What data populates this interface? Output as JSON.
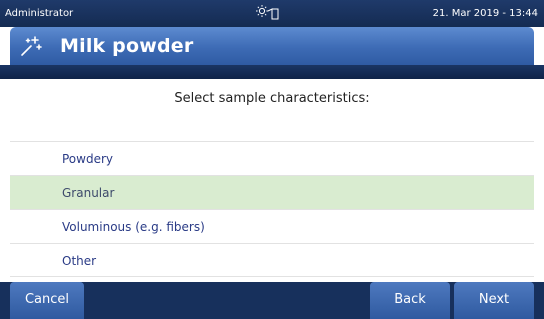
{
  "status_bar": {
    "user": "Administrator",
    "datetime": "21. Mar 2019 - 13:44",
    "icon": "light-door-icon"
  },
  "header": {
    "title": "Milk powder",
    "icon": "sparkle-wand-icon"
  },
  "prompt": "Select sample characteristics:",
  "options": [
    {
      "label": "Powdery",
      "selected": false
    },
    {
      "label": "Granular",
      "selected": true
    },
    {
      "label": "Voluminous (e.g. fibers)",
      "selected": false
    },
    {
      "label": "Other",
      "selected": false
    }
  ],
  "footer": {
    "cancel_label": "Cancel",
    "back_label": "Back",
    "next_label": "Next"
  },
  "colors": {
    "header_gradient_top": "#5d8bd0",
    "header_gradient_bottom": "#2f5ba4",
    "dark_bar": "#17305c",
    "selected_row": "#d9ecd0",
    "option_text": "#2a3b86"
  }
}
